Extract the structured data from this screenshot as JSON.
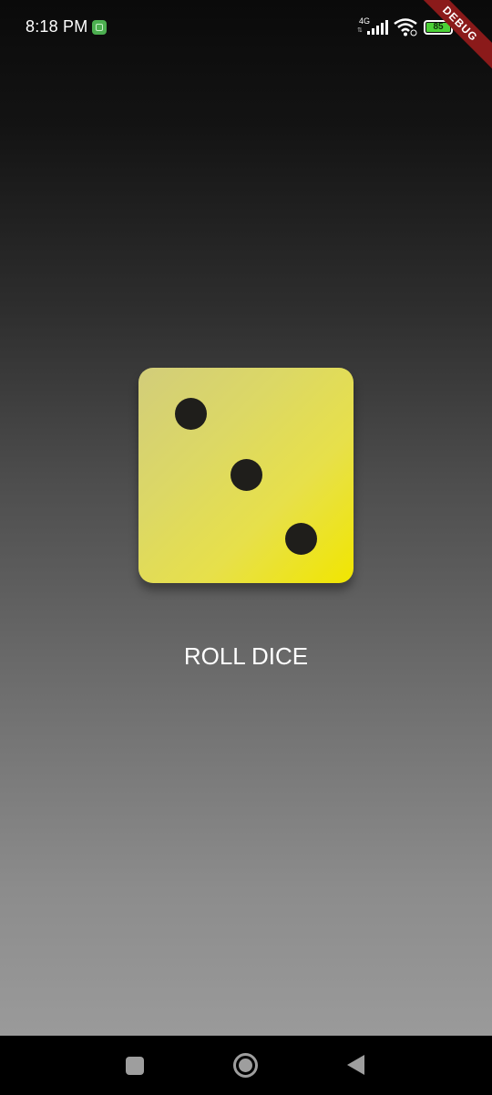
{
  "status_bar": {
    "time": "8:18 PM",
    "network_type": "4G",
    "network_activity": "⇅",
    "battery_level": "85",
    "icons": [
      "app-notification-icon",
      "signal-icon",
      "wifi-icon",
      "battery-icon"
    ]
  },
  "debug_banner": {
    "label": "DEBUG"
  },
  "dice": {
    "face_value": 3,
    "pips": 3,
    "colors": {
      "start": "#d2cd7a",
      "end": "#f1e600",
      "pip": "#1f1e1b"
    }
  },
  "actions": {
    "roll_label": "ROLL DICE"
  },
  "nav_bar": {
    "icons": [
      "recent-apps-icon",
      "home-icon",
      "back-icon"
    ]
  },
  "colors": {
    "background_top": "#0a0a0a",
    "background_bottom": "#9a9a9a",
    "debug_banner": "#8b1a1a",
    "battery": "#4cd137"
  }
}
